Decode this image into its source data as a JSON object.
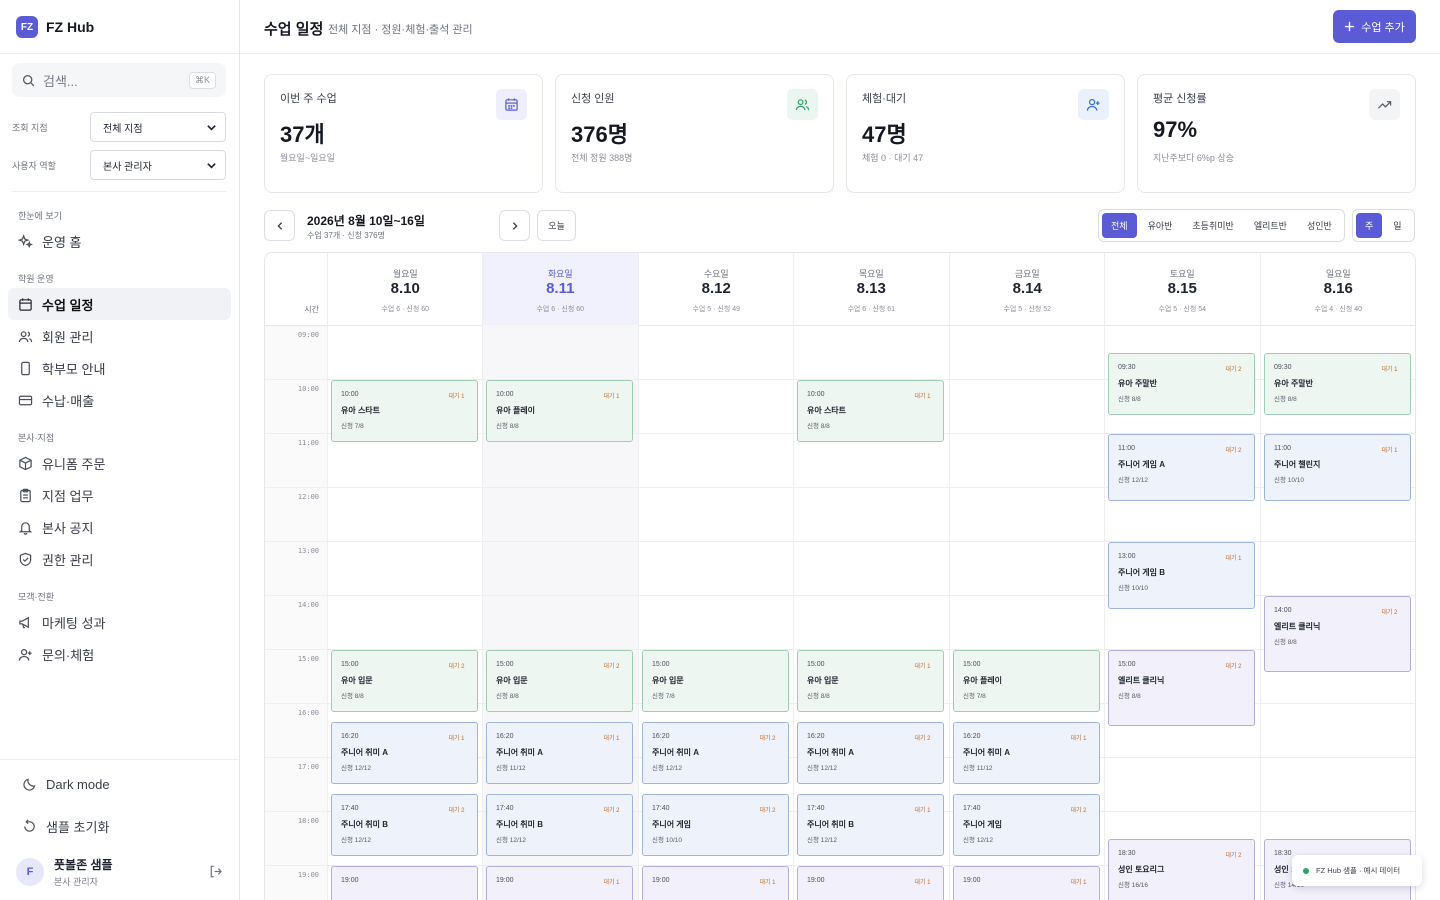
{
  "brand": {
    "logo": "FZ",
    "name": "FZ Hub"
  },
  "search": {
    "placeholder": "검색...",
    "shortcut": "⌘K"
  },
  "filters": {
    "branch_label": "조회 지점",
    "branch_value": "전체 지점",
    "role_label": "사용자 역할",
    "role_value": "본사 관리자"
  },
  "nav": {
    "sections": [
      "한눈에 보기",
      "학원 운영",
      "본사·지점",
      "모객·전환"
    ],
    "items": [
      {
        "label": "운영 홈",
        "icon": "sparkle-icon"
      },
      {
        "label": "수업 일정",
        "icon": "calendar-icon",
        "active": true
      },
      {
        "label": "회원 관리",
        "icon": "users-icon"
      },
      {
        "label": "학부모 안내",
        "icon": "phone-icon"
      },
      {
        "label": "수납·매출",
        "icon": "card-icon"
      },
      {
        "label": "유니폼 주문",
        "icon": "package-icon"
      },
      {
        "label": "지점 업무",
        "icon": "clipboard-icon"
      },
      {
        "label": "본사 공지",
        "icon": "bell-icon"
      },
      {
        "label": "권한 관리",
        "icon": "shield-icon"
      },
      {
        "label": "마케팅 성과",
        "icon": "megaphone-icon"
      },
      {
        "label": "문의·체험",
        "icon": "user-plus-icon"
      }
    ]
  },
  "bottom": {
    "dark_mode": "Dark mode",
    "reset": "샘플 초기화"
  },
  "user": {
    "initial": "F",
    "name": "풋볼존 샘플",
    "role": "본사 관리자"
  },
  "header": {
    "title": "수업 일정",
    "subtitle": "전체 지점 · 정원·체험·출석 관리",
    "add_button": "수업 추가"
  },
  "stats": [
    {
      "label": "이번 주 수업",
      "value": "37개",
      "note": "월요일~일요일",
      "icon": "calendar-icon",
      "accent": "#5b5bd6"
    },
    {
      "label": "신청 인원",
      "value": "376명",
      "note": "전체 정원 388명",
      "icon": "users-icon",
      "accent": "#2fa36b"
    },
    {
      "label": "체험·대기",
      "value": "47명",
      "note": "체험 0 · 대기 47",
      "icon": "user-plus-icon",
      "accent": "#3b6fd6"
    },
    {
      "label": "평균 신청률",
      "value": "97%",
      "note": "지난주보다 6%p 상승",
      "icon": "trend-up-icon",
      "accent": "#555a66"
    }
  ],
  "week": {
    "title": "2026년 8월 10일~16일",
    "subtitle": "수업 37개 · 신청 376명",
    "today": "오늘"
  },
  "level_filters": [
    "전체",
    "유아반",
    "초등취미반",
    "엘리트반",
    "성인반"
  ],
  "view_toggle": [
    "주",
    "일"
  ],
  "calendar": {
    "time_label": "시간",
    "hours": [
      "09:00",
      "10:00",
      "11:00",
      "12:00",
      "13:00",
      "14:00",
      "15:00",
      "16:00",
      "17:00",
      "18:00",
      "19:00"
    ],
    "days": [
      {
        "name": "월요일",
        "date": "8.10",
        "count": "수업 6 · 신청 60"
      },
      {
        "name": "화요일",
        "date": "8.11",
        "count": "수업 6 · 신청 60",
        "today": true
      },
      {
        "name": "수요일",
        "date": "8.12",
        "count": "수업 5 · 신청 49"
      },
      {
        "name": "목요일",
        "date": "8.13",
        "count": "수업 6 · 신청 61"
      },
      {
        "name": "금요일",
        "date": "8.14",
        "count": "수업 5 · 신청 52"
      },
      {
        "name": "토요일",
        "date": "8.15",
        "count": "수업 5 · 신청 54"
      },
      {
        "name": "일요일",
        "date": "8.16",
        "count": "수업 4 · 신청 40"
      }
    ],
    "events": [
      {
        "day": 0,
        "start": "10:00",
        "end": "11:10",
        "name": "유아 스타트",
        "cap": "신청 7/8",
        "badge": "대기 1",
        "color": "green"
      },
      {
        "day": 0,
        "start": "15:00",
        "end": "16:10",
        "name": "유아 입문",
        "cap": "신청 8/8",
        "badge": "대기 2",
        "color": "green"
      },
      {
        "day": 0,
        "start": "16:20",
        "end": "17:30",
        "name": "주니어 취미 A",
        "cap": "신청 12/12",
        "badge": "대기 1",
        "color": "blue"
      },
      {
        "day": 0,
        "start": "17:40",
        "end": "18:50",
        "name": "주니어 취미 B",
        "cap": "신청 12/12",
        "badge": "대기 2",
        "color": "blue"
      },
      {
        "day": 0,
        "start": "19:00",
        "end": "20:10",
        "name": "",
        "cap": "",
        "badge": "",
        "color": "purple"
      },
      {
        "day": 1,
        "start": "10:00",
        "end": "11:10",
        "name": "유아 플레이",
        "cap": "신청 8/8",
        "badge": "대기 1",
        "color": "green"
      },
      {
        "day": 1,
        "start": "15:00",
        "end": "16:10",
        "name": "유아 입문",
        "cap": "신청 8/8",
        "badge": "대기 2",
        "color": "green"
      },
      {
        "day": 1,
        "start": "16:20",
        "end": "17:30",
        "name": "주니어 취미 A",
        "cap": "신청 11/12",
        "badge": "대기 1",
        "color": "blue"
      },
      {
        "day": 1,
        "start": "17:40",
        "end": "18:50",
        "name": "주니어 취미 B",
        "cap": "신청 12/12",
        "badge": "대기 2",
        "color": "blue"
      },
      {
        "day": 1,
        "start": "19:00",
        "end": "20:10",
        "name": "",
        "cap": "",
        "badge": "대기 1",
        "color": "purple"
      },
      {
        "day": 2,
        "start": "15:00",
        "end": "16:10",
        "name": "유아 입문",
        "cap": "신청 7/8",
        "badge": "",
        "color": "green"
      },
      {
        "day": 2,
        "start": "16:20",
        "end": "17:30",
        "name": "주니어 취미 A",
        "cap": "신청 12/12",
        "badge": "대기 2",
        "color": "blue"
      },
      {
        "day": 2,
        "start": "17:40",
        "end": "18:50",
        "name": "주니어 게임",
        "cap": "신청 10/10",
        "badge": "대기 2",
        "color": "blue"
      },
      {
        "day": 2,
        "start": "19:00",
        "end": "20:10",
        "name": "",
        "cap": "",
        "badge": "대기 1",
        "color": "purple"
      },
      {
        "day": 3,
        "start": "10:00",
        "end": "11:10",
        "name": "유아 스타트",
        "cap": "신청 8/8",
        "badge": "대기 1",
        "color": "green"
      },
      {
        "day": 3,
        "start": "15:00",
        "end": "16:10",
        "name": "유아 입문",
        "cap": "신청 8/8",
        "badge": "대기 1",
        "color": "green"
      },
      {
        "day": 3,
        "start": "16:20",
        "end": "17:30",
        "name": "주니어 취미 A",
        "cap": "신청 12/12",
        "badge": "대기 2",
        "color": "blue"
      },
      {
        "day": 3,
        "start": "17:40",
        "end": "18:50",
        "name": "주니어 취미 B",
        "cap": "신청 12/12",
        "badge": "대기 1",
        "color": "blue"
      },
      {
        "day": 3,
        "start": "19:00",
        "end": "20:10",
        "name": "",
        "cap": "",
        "badge": "대기 1",
        "color": "purple"
      },
      {
        "day": 4,
        "start": "15:00",
        "end": "16:10",
        "name": "유아 플레이",
        "cap": "신청 7/8",
        "badge": "",
        "color": "green"
      },
      {
        "day": 4,
        "start": "16:20",
        "end": "17:30",
        "name": "주니어 취미 A",
        "cap": "신청 11/12",
        "badge": "대기 1",
        "color": "blue"
      },
      {
        "day": 4,
        "start": "17:40",
        "end": "18:50",
        "name": "주니어 게임",
        "cap": "신청 12/12",
        "badge": "대기 2",
        "color": "blue"
      },
      {
        "day": 4,
        "start": "19:00",
        "end": "20:10",
        "name": "",
        "cap": "",
        "badge": "대기 1",
        "color": "purple"
      },
      {
        "day": 5,
        "start": "09:30",
        "end": "10:40",
        "name": "유아 주말반",
        "cap": "신청 8/8",
        "badge": "대기 2",
        "color": "green"
      },
      {
        "day": 5,
        "start": "11:00",
        "end": "12:15",
        "name": "주니어 게임 A",
        "cap": "신청 12/12",
        "badge": "대기 2",
        "color": "blue"
      },
      {
        "day": 5,
        "start": "13:00",
        "end": "14:15",
        "name": "주니어 게임 B",
        "cap": "신청 10/10",
        "badge": "대기 1",
        "color": "blue"
      },
      {
        "day": 5,
        "start": "15:00",
        "end": "16:25",
        "name": "엘리트 클리닉",
        "cap": "신청 8/8",
        "badge": "대기 2",
        "color": "purple"
      },
      {
        "day": 5,
        "start": "18:30",
        "end": "19:45",
        "name": "성인 토요리그",
        "cap": "신청 16/16",
        "badge": "대기 2",
        "color": "purple"
      },
      {
        "day": 6,
        "start": "09:30",
        "end": "10:40",
        "name": "유아 주말반",
        "cap": "신청 8/8",
        "badge": "대기 1",
        "color": "green"
      },
      {
        "day": 6,
        "start": "11:00",
        "end": "12:15",
        "name": "주니어 챌린지",
        "cap": "신청 10/10",
        "badge": "대기 1",
        "color": "blue"
      },
      {
        "day": 6,
        "start": "14:00",
        "end": "15:25",
        "name": "엘리트 클리닉",
        "cap": "신청 8/8",
        "badge": "대기 2",
        "color": "purple"
      },
      {
        "day": 6,
        "start": "18:30",
        "end": "19:45",
        "name": "성인 :",
        "cap": "신청 14/16",
        "badge": "",
        "color": "purple"
      }
    ]
  },
  "toast": "FZ Hub 샘플 · 예시 데이터"
}
